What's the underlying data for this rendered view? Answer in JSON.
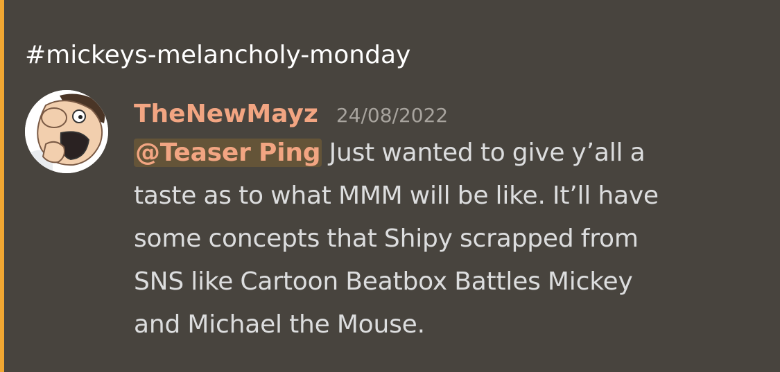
{
  "channel": {
    "name": "#mickeys-melancholy-monday"
  },
  "message": {
    "author": "TheNewMayz",
    "timestamp": "24/08/2022",
    "avatar_icon": "cartoon-face-avatar",
    "mention": "@Teaser Ping",
    "lines": [
      " Just wanted to give y’all a",
      "taste as to what MMM will be like. It’ll have",
      "some concepts that Shipy scrapped from",
      "SNS like Cartoon Beatbox Battles Mickey",
      "and Michael the Mouse."
    ]
  },
  "colors": {
    "background": "#48443e",
    "accent_bar": "#f0a732",
    "username": "#f2a582",
    "text": "#dcddde",
    "timestamp": "#a8a49e"
  }
}
